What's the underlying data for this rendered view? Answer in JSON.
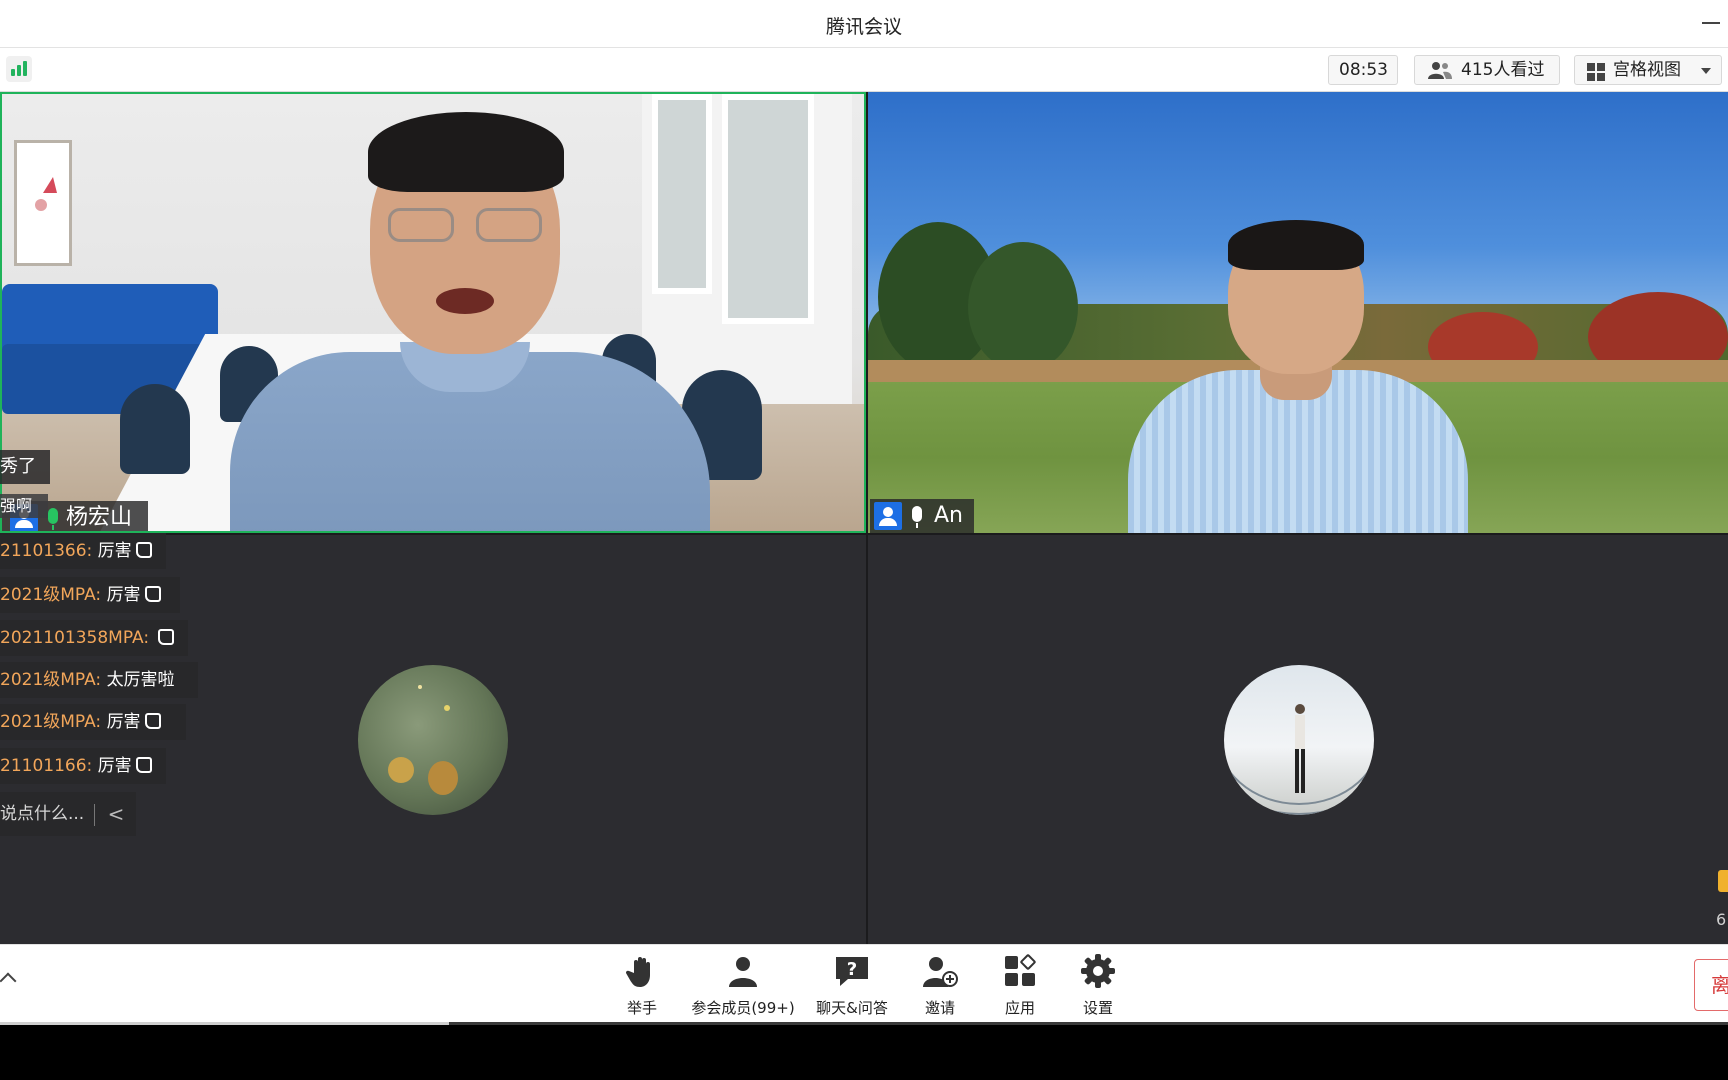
{
  "window": {
    "title": "腾讯会议"
  },
  "topbar": {
    "timer": "08:53",
    "viewers": "415人看过",
    "view_mode": "宫格视图"
  },
  "participants": [
    {
      "name": "杨宏山",
      "mic": "on"
    },
    {
      "name": "An",
      "mic": "on"
    }
  ],
  "chat": {
    "partial_top": "秀了",
    "partial_second": "强啊",
    "messages": [
      {
        "sender": "21101366:",
        "text": "厉害",
        "thumb": true
      },
      {
        "sender": "2021级MPA:",
        "text": "厉害",
        "thumb": true
      },
      {
        "sender": "2021101358MPA:",
        "text": "",
        "thumb": true
      },
      {
        "sender": "2021级MPA:",
        "text": "太厉害啦",
        "thumb": false
      },
      {
        "sender": "2021级MPA:",
        "text": "厉害",
        "thumb": true
      },
      {
        "sender": "21101166:",
        "text": "厉害",
        "thumb": true
      }
    ],
    "input_placeholder": "说点什么...",
    "collapse_glyph": "<"
  },
  "toolbar": {
    "raise_hand": "举手",
    "members": "参会成员(99+)",
    "chat_qa": "聊天&问答",
    "invite": "邀请",
    "apps": "应用",
    "settings": "设置",
    "leave": "离"
  },
  "edge_counter": "6",
  "colors": {
    "active_speaker_border": "#1fb35a",
    "chat_sender": "#f2a65a",
    "signal": "#22b35e",
    "user_badge": "#1d6fe5",
    "leave": "#d63a3a"
  },
  "playback": {
    "progress": 0.26
  }
}
